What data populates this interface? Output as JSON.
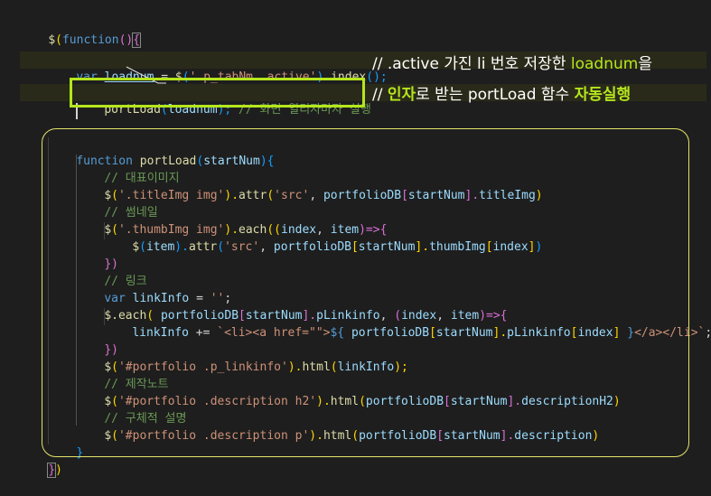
{
  "code": {
    "l1_dollar": "$",
    "l1_paren_open": "(",
    "l1_function": "function",
    "l1_parens": "()",
    "l1_brace": "{",
    "l2_var": "var",
    "l2_name": "loadnum",
    "l2_eq": " = ",
    "l2_dollar": "$",
    "l2_open": "(",
    "l2_str": "'.p_tabNm .active'",
    "l2_close": ").",
    "l2_index": "index",
    "l2_end": "();",
    "l3_fn": "portLoad",
    "l3_open": "(",
    "l3_arg": "loadnum",
    "l3_close": ");",
    "l3_comment": " // 화면 열리자마자 실행",
    "l4_function": "function",
    "l4_name": "portLoad",
    "l4_open": "(",
    "l4_param": "startNum",
    "l4_close": ")",
    "l4_brace": "{",
    "l5_comment": "// 대표이미지",
    "l6_dollar": "$",
    "l6_open": "(",
    "l6_str": "'.titleImg img'",
    "l6_mid": ").",
    "l6_attr": "attr",
    "l6_open2": "(",
    "l6_str2": "'src'",
    "l6_comma": ", ",
    "l6_db": "portfolioDB",
    "l6_sq": "[",
    "l6_idx": "startNum",
    "l6_sqc": "].",
    "l6_prop": "titleImg",
    "l6_end": ")",
    "l7_comment": "// 썸네일",
    "l8_dollar": "$",
    "l8_open": "(",
    "l8_str": "'.thumbImg img'",
    "l8_mid": ").",
    "l8_each": "each",
    "l8_open2": "((",
    "l8_p1": "index",
    "l8_comma": ", ",
    "l8_p2": "item",
    "l8_arrow": ")=>",
    "l8_brace": "{",
    "l9_dollar": "$",
    "l9_open": "(",
    "l9_item": "item",
    "l9_mid": ").",
    "l9_attr": "attr",
    "l9_open2": "(",
    "l9_str": "'src'",
    "l9_comma": ", ",
    "l9_db": "portfolioDB",
    "l9_sq": "[",
    "l9_idx": "startNum",
    "l9_sqc": "].",
    "l9_prop": "thumbImg",
    "l9_sq2": "[",
    "l9_index": "index",
    "l9_sqc2": "]",
    "l9_end": ")",
    "l10_brace": "})",
    "l11_comment": "// 링크",
    "l12_var": "var",
    "l12_name": "linkInfo",
    "l12_eq": " = ",
    "l12_str": "''",
    "l12_end": ";",
    "l13_dollar": "$",
    "l13_each": ".each",
    "l13_open": "( ",
    "l13_db": "portfolioDB",
    "l13_sq": "[",
    "l13_idx": "startNum",
    "l13_sqc": "].",
    "l13_prop": "pLinkinfo",
    "l13_comma": ", ",
    "l13_open2": "(",
    "l13_p1": "index",
    "l13_comma2": ", ",
    "l13_p2": "item",
    "l13_arrow": ")=>",
    "l13_brace": "{",
    "l14_name": "linkInfo",
    "l14_op": " += ",
    "l14_str1": "`<li><a href=\"\">",
    "l14_interp_open": "${",
    "l14_db": " portfolioDB",
    "l14_sq": "[",
    "l14_idx": "startNum",
    "l14_sqc": "].",
    "l14_prop": "pLinkinfo",
    "l14_sq2": "[",
    "l14_index": "index",
    "l14_sqc2": "] ",
    "l14_interp_close": "}",
    "l14_str2": "</a></li>`",
    "l14_end": ";",
    "l15_brace": "})",
    "l16_dollar": "$",
    "l16_open": "(",
    "l16_str": "'#portfolio .p_linkinfo'",
    "l16_mid": ").",
    "l16_html": "html",
    "l16_open2": "(",
    "l16_arg": "linkInfo",
    "l16_end": ");",
    "l17_comment": "// 제작노트",
    "l18_dollar": "$",
    "l18_open": "(",
    "l18_str": "'#portfolio .description h2'",
    "l18_mid": ").",
    "l18_html": "html",
    "l18_open2": "(",
    "l18_db": "portfolioDB",
    "l18_sq": "[",
    "l18_idx": "startNum",
    "l18_sqc": "].",
    "l18_prop": "descriptionH2",
    "l18_end": ")",
    "l19_comment": "// 구체적 설명",
    "l20_dollar": "$",
    "l20_open": "(",
    "l20_str": "'#portfolio .description p'",
    "l20_mid": ").",
    "l20_html": "html",
    "l20_open2": "(",
    "l20_db": "portfolioDB",
    "l20_sq": "[",
    "l20_idx": "startNum",
    "l20_sqc": "].",
    "l20_prop": "description",
    "l20_end": ")",
    "l21_brace": "}",
    "l22_brace": "}",
    "l22_paren": ")"
  },
  "annotations": {
    "note1_prefix": "// .active 가진 li 번호 저장한 ",
    "note1_highlight": "loadnum",
    "note1_suffix": "을",
    "note2_prefix": "// ",
    "note2_bold1": "인자",
    "note2_mid": "로 받는 portLoad 함수 ",
    "note2_bold2": "자동실행"
  },
  "colors": {
    "background": "#1e1e1e",
    "keyword": "#569cd6",
    "function": "#dcdcaa",
    "string": "#ce9178",
    "variable": "#9cdcfe",
    "comment": "#6a9955",
    "annotation_green": "#b5e61d",
    "annotation_yellow": "#e4e46a"
  }
}
